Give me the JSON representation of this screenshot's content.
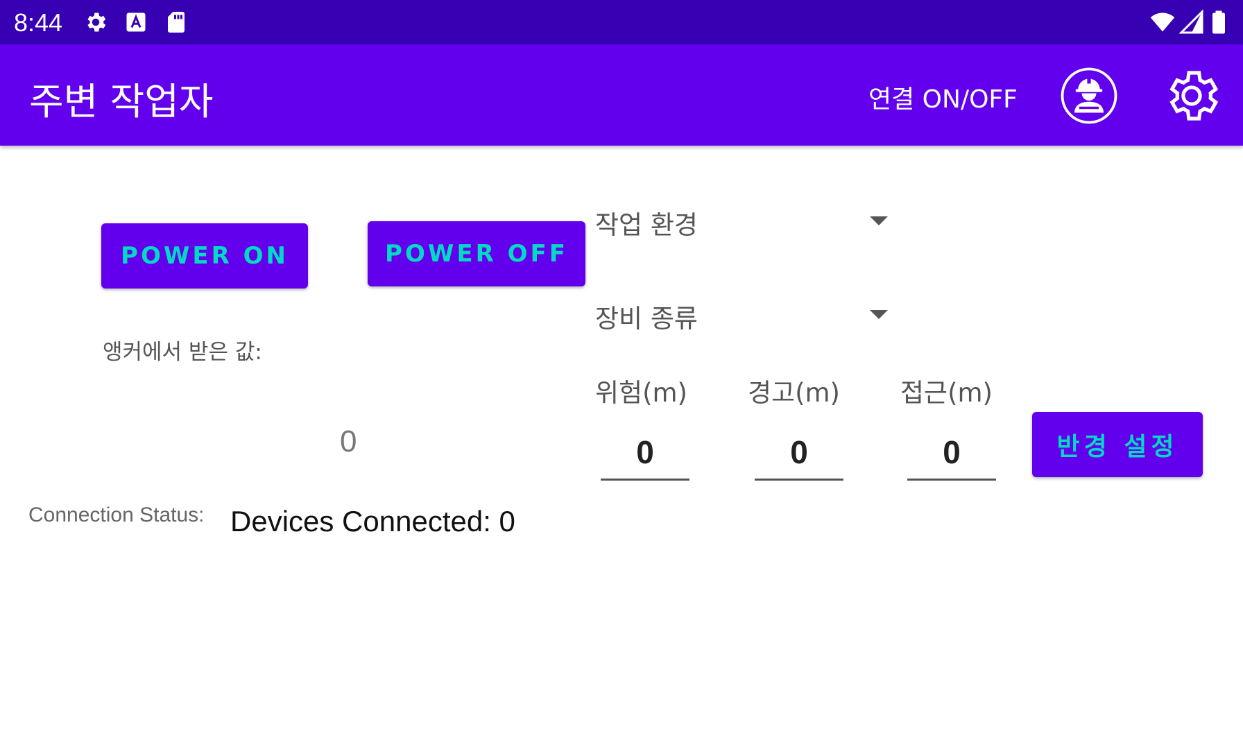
{
  "status_bar": {
    "time": "8:44",
    "icons": [
      "settings-icon",
      "keyboard-a-icon",
      "sd-card-icon",
      "wifi-icon",
      "cell-signal-icon",
      "battery-icon"
    ]
  },
  "app_bar": {
    "title": "주변 작업자",
    "connection_toggle_label": "연결 ON/OFF",
    "worker_icon": "worker-helmet-icon",
    "settings_icon": "gear-icon",
    "background_color": "#6200ee"
  },
  "power": {
    "on_label": "POWER ON",
    "off_label": "POWER OFF"
  },
  "anchor": {
    "label": "앵커에서 받은 값:",
    "value": "0"
  },
  "spinners": {
    "work_environment": "작업 환경",
    "equipment_type": "장비 종류"
  },
  "distances": {
    "danger_label": "위험(m)",
    "danger_value": "0",
    "warning_label": "경고(m)",
    "warning_value": "0",
    "approach_label": "접근(m)",
    "approach_value": "0"
  },
  "apply_button_label": "반경 설정",
  "connection": {
    "status_label": "Connection Status:",
    "devices_text": "Devices Connected: 0"
  },
  "colors": {
    "status_bar": "#3700b3",
    "primary": "#6200ee",
    "button_text": "#03dac5"
  }
}
